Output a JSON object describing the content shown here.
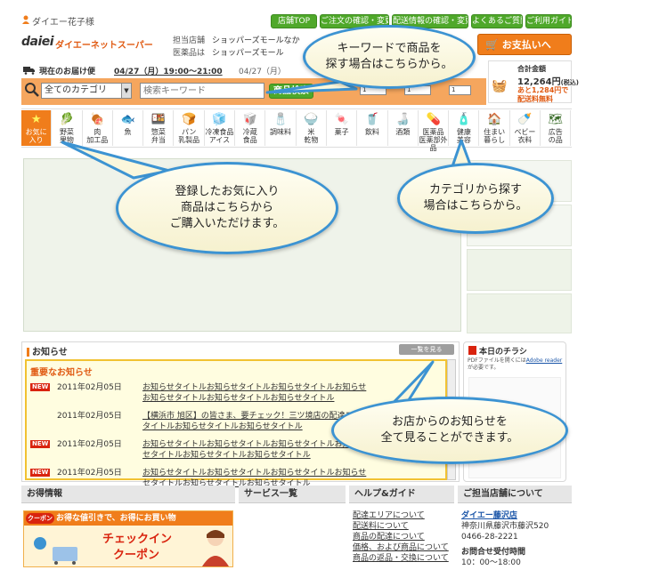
{
  "header": {
    "user_label": "ダイエー花子様",
    "logo_mark": "daiei",
    "logo_text": "ダイエーネットスーパー",
    "top_buttons": [
      "店舗TOP",
      "ご注文の確認・変更",
      "配送情報の確認・変更",
      "よくあるご質問",
      "ご利用ガイド"
    ],
    "store_rows": [
      {
        "label": "担当店舗",
        "value": "ショッパーズモールなか"
      },
      {
        "label": "医薬品は",
        "value": "ショッパーズモール"
      }
    ],
    "checkout_label": "お支払いへ",
    "delivery_label": "現在のお届け便",
    "delivery_value": "04/27（月）19:00〜21:00",
    "delivery_value2": "04/27（月）",
    "total_label": "合計金額",
    "total_value": "12,264円",
    "total_note": "(税込)",
    "free_shipping_line1": "あと1,284円で",
    "free_shipping_line2": "配送料無料"
  },
  "search": {
    "category_value": "全てのカテゴリ",
    "keyword_placeholder": "検索キーワード",
    "button_label": "商品検索",
    "small_value": "1"
  },
  "categories": [
    {
      "label": "お気に\n入り",
      "icon": "star-icon"
    },
    {
      "label": "野菜\n果物",
      "icon": "vegetable-icon"
    },
    {
      "label": "肉\n加工品",
      "icon": "meat-icon"
    },
    {
      "label": "魚",
      "icon": "fish-icon"
    },
    {
      "label": "惣菜\n弁当",
      "icon": "bento-icon"
    },
    {
      "label": "パン\n乳製品",
      "icon": "bread-icon"
    },
    {
      "label": "冷凍食品\nアイス",
      "icon": "frozen-icon"
    },
    {
      "label": "冷蔵\n食品",
      "icon": "chilled-icon"
    },
    {
      "label": "調味料",
      "icon": "seasoning-icon"
    },
    {
      "label": "米\n乾物",
      "icon": "rice-icon"
    },
    {
      "label": "菓子",
      "icon": "snack-icon"
    },
    {
      "label": "飲料",
      "icon": "drink-icon"
    },
    {
      "label": "酒類",
      "icon": "alcohol-icon"
    },
    {
      "label": "医薬品\n医薬部外品",
      "icon": "medicine-icon"
    },
    {
      "label": "健康\n美容",
      "icon": "health-icon"
    },
    {
      "label": "住まい\n暮らし",
      "icon": "home-icon"
    },
    {
      "label": "ベビー\n衣料",
      "icon": "baby-icon"
    },
    {
      "label": "広告\nの品",
      "icon": "flyer-icon"
    }
  ],
  "notices": {
    "title": "お知らせ",
    "view_all": "一覧を見る",
    "important_title": "重要なお知らせ",
    "new_badge": "NEW",
    "rows": [
      {
        "new": true,
        "date": "2011年02月05日",
        "title": "お知らせタイトルお知らせタイトルお知らせタイトルお知らせ\nお知らせタイトルお知らせタイトルお知らせタイトル"
      },
      {
        "new": false,
        "date": "2011年02月05日",
        "title": "【横浜市 旭区】の皆さま、要チェック！三ツ境店の配達エリア\nタイトルお知らせタイトルお知らせタイトル"
      },
      {
        "new": true,
        "date": "2011年02月05日",
        "title": "お知らせタイトルお知らせタイトルお知らせタイトルお知らせ\nセタイトルお知らせタイトルお知らせタイトル"
      },
      {
        "new": true,
        "date": "2011年02月05日",
        "title": "お知らせタイトルお知らせタイトルお知らせタイトルお知らせ\nセタイトルお知らせタイトルお知らせタイトル"
      }
    ]
  },
  "flyer": {
    "title": "本日のチラシ",
    "note_pre": "PDFファイルを開くには",
    "note_link": "Adobe reader",
    "note_post": "が必要です。"
  },
  "footer": {
    "deals_title": "お得情報",
    "coupon_badge": "クーポン",
    "coupon_top": "お得な値引きで、お得にお買い物",
    "coupon_line1": "チェックイン",
    "coupon_line2": "クーポン",
    "services_title": "サービス一覧",
    "help_title": "ヘルプ&ガイド",
    "help_links": [
      "配達エリアについて",
      "配送料について",
      "商品の配達について",
      "価格、および商品について",
      "商品の返品・交換について"
    ],
    "store_title": "ご担当店舗について",
    "store_name": "ダイエー藤沢店",
    "store_address": "神奈川県藤沢市藤沢520",
    "store_phone": "0466-28-2221",
    "hours_title": "お問合せ受付時間",
    "hours_value": "10：00〜18:00"
  },
  "callouts": {
    "keyword": "キーワードで商品を\n探す場合はこちらから。",
    "favorites": "登録したお気に入り\n商品はこちらから\nご購入いただけます。",
    "category": "カテゴリから探す\n場合はこちらから。",
    "notices": "お店からのお知らせを\n全て見ることができます。"
  },
  "colors": {
    "accent_orange": "#f07d1b",
    "green": "#4fa82a",
    "callout_border": "#3c93d2",
    "notice_red": "#d9230e"
  }
}
